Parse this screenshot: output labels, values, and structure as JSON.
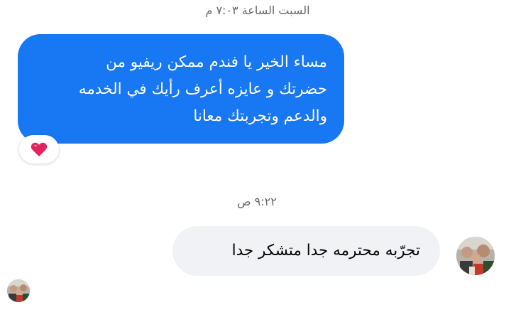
{
  "chat": {
    "timestamp_1": "السبت الساعة ٧:٠٣ م",
    "outgoing_message": {
      "lines": [
        "مساء الخير يا فندم ممكن ريفيو من",
        "حضرتك و عايزه أعرف رأيك في الخدمه",
        "والدعم وتجربتك معانا"
      ],
      "reaction": "heart-icon"
    },
    "timestamp_2": "٩:٢٢ ص",
    "incoming_message": "تجرّبه محترمه جدا  متشكر جدا"
  },
  "colors": {
    "outgoing_bubble": "#1877f2",
    "incoming_bubble": "#f0f2f5",
    "timestamp": "#65676b",
    "heart": "#e0245e"
  }
}
